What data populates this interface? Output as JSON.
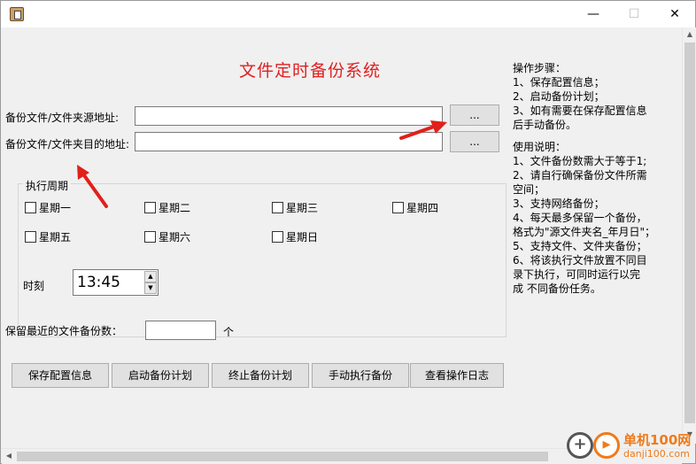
{
  "window": {
    "minimize_glyph": "—",
    "maximize_glyph": "☐",
    "close_glyph": "✕"
  },
  "app_title": "文件定时备份系统",
  "source": {
    "label": "备份文件/文件夹源地址:",
    "value": "",
    "browse_label": "..."
  },
  "destination": {
    "label": "备份文件/文件夹目的地址:",
    "value": "",
    "browse_label": "..."
  },
  "schedule": {
    "title": "执行周期",
    "days": [
      "星期一",
      "星期二",
      "星期三",
      "星期四",
      "星期五",
      "星期六",
      "星期日"
    ],
    "checked": [
      false,
      false,
      false,
      false,
      false,
      false,
      false
    ],
    "time_label": "时刻",
    "time_value": "13:45"
  },
  "retain": {
    "label": "保留最近的文件备份数：",
    "value": "",
    "unit": "个"
  },
  "buttons": {
    "save": "保存配置信息",
    "start": "启动备份计划",
    "stop": "终止备份计划",
    "manual": "手动执行备份",
    "log": "查看操作日志"
  },
  "help": {
    "steps_title": "操作步骤：",
    "steps": [
      "1、保存配置信息；",
      "2、启动备份计划；",
      "3、如有需要在保存配置信息",
      "     后手动备份。"
    ],
    "usage_title": "使用说明：",
    "usage": [
      "1、文件备份数需大于等于1;",
      "2、请自行确保备份文件所需",
      "空间；",
      "3、支持网络备份；",
      "4、每天最多保留一个备份，",
      "格式为\"源文件夹名_年月日\"；",
      "5、支持文件、文件夹备份；",
      "6、将该执行文件放置不同目",
      "录下执行，可同时运行以完",
      "成 不同备份任务。"
    ]
  },
  "watermark": {
    "brand": "单机100网",
    "url": "danji100.com"
  },
  "colors": {
    "title_red": "#e02020",
    "arrow_red": "#e0201a",
    "watermark_orange": "#f07a1a"
  }
}
